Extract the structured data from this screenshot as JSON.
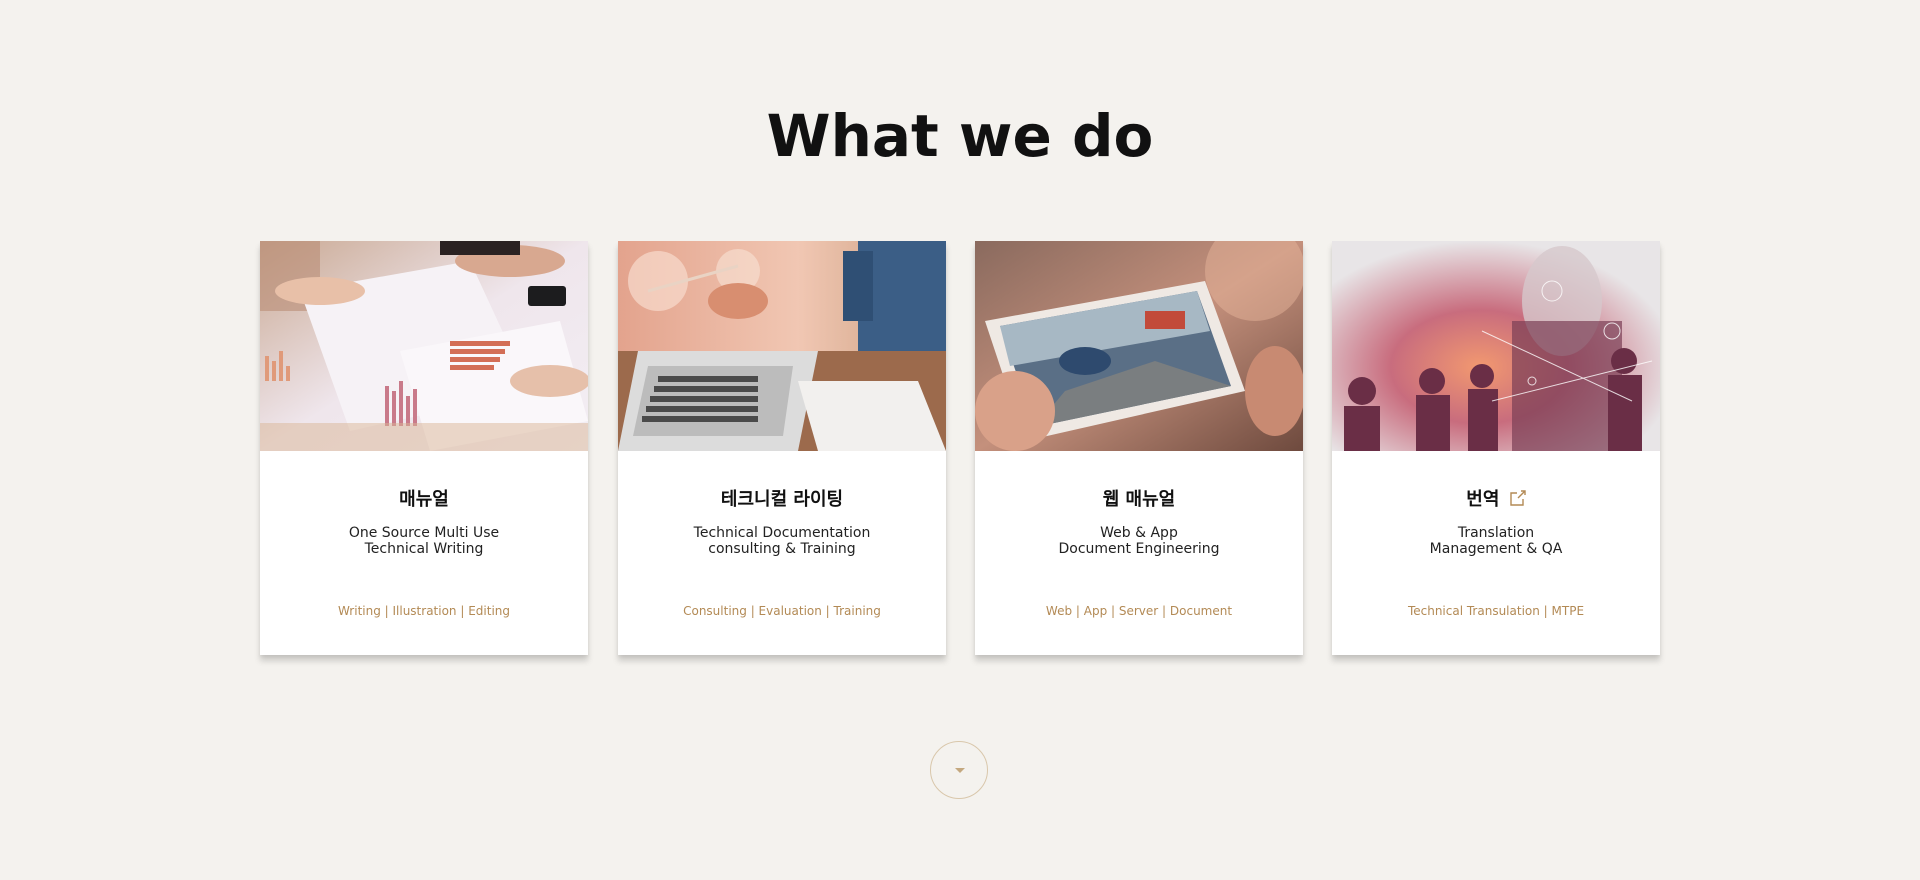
{
  "section": {
    "title": "What we do"
  },
  "cards": [
    {
      "title": "매뉴얼",
      "desc_line1": "One Source Multi Use",
      "desc_line2": "Technical Writing",
      "tags": "Writing | Illustration | Editing",
      "image": "photo of hands reviewing printed charts on a desk"
    },
    {
      "title": "테크니컬 라이팅",
      "desc_line1": "Technical Documentation",
      "desc_line2": "consulting & Training",
      "tags": "Consulting | Evaluation | Training",
      "image": "photo of a person with a pencil working at a laptop"
    },
    {
      "title": "웹 매뉴얼",
      "desc_line1": "Web & App",
      "desc_line2": "Document Engineering",
      "tags": "Web | App | Server | Document",
      "image": "photo of hands holding a tablet showing a car"
    },
    {
      "title": "번역",
      "title_icon": "external-link-icon",
      "desc_line1": "Translation",
      "desc_line2": "Management & QA",
      "tags": "Technical Transulation | MTPE",
      "image": "double exposure of business people and city skyline"
    }
  ],
  "scroll_button": {
    "icon": "caret-down-icon"
  },
  "colors": {
    "background": "#f4f2ee",
    "accent": "#b38a55",
    "card": "#ffffff"
  }
}
